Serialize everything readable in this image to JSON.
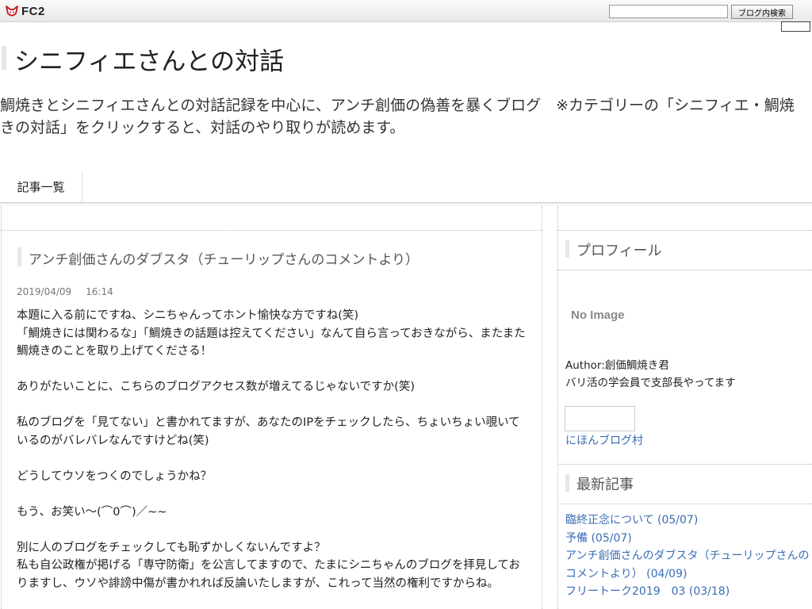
{
  "fc2bar": {
    "logo_text": "FC2",
    "search_placeholder": "",
    "search_button_label": "ブログ内検索"
  },
  "header": {
    "title": "シニフィエさんとの対話",
    "description": "鯛焼きとシニフィエさんとの対話記録を中心に、アンチ創価の偽善を暴くブログ　※カテゴリーの「シニフィエ・鯛焼きの対話」をクリックすると、対話のやり取りが読めます。"
  },
  "nav": {
    "items": [
      {
        "label": "記事一覧"
      }
    ]
  },
  "entry": {
    "title": "アンチ創価さんのダブスタ（チューリップさんのコメントより）",
    "date": "2019/04/09",
    "time": "16:14",
    "paragraphs": [
      "本題に入る前にですね、シニちゃんってホント愉快な方ですね(笑)",
      "「鯛焼きには関わるな」「鯛焼きの話題は控えてください」なんて自ら言っておきながら、またまた鯛焼きのことを取り上げてくださる！",
      "",
      "ありがたいことに、こちらのブログアクセス数が増えてるじゃないですか(笑)",
      "",
      "私のブログを「見てない」と書かれてますが、あなたのIPをチェックしたら、ちょいちょい覗いているのがバレバレなんですけどね(笑)",
      "",
      "どうしてウソをつくのでしょうかね？",
      "",
      "もう、お笑い～(⌒0⌒)／~~",
      "",
      "別に人のブログをチェックしても恥ずかしくないんですよ？",
      "私も自公政権が掲げる「専守防衛」を公言してますので、たまにシニちゃんのブログを拝見しておりますし、ウソや誹謗中傷が書かれれば反論いたしますが、これって当然の権利ですからね。"
    ]
  },
  "sidebar": {
    "profile": {
      "heading": "プロフィール",
      "image_text": "No Image",
      "author_line": "Author:創価鯛焼き君",
      "bio": "バリ活の学会員で支部長やってます",
      "banner_link": "にほんブログ村"
    },
    "recent": {
      "heading": "最新記事",
      "items": [
        {
          "label": "臨終正念について (05/07)"
        },
        {
          "label": "予備 (05/07)"
        },
        {
          "label": "アンチ創価さんのダブスタ（チューリップさんのコメントより） (04/09)"
        },
        {
          "label": "フリートーク2019　03 (03/18)"
        }
      ]
    }
  },
  "colors": {
    "link": "#3a6db5",
    "heading_accent": "#e6e6e6"
  }
}
